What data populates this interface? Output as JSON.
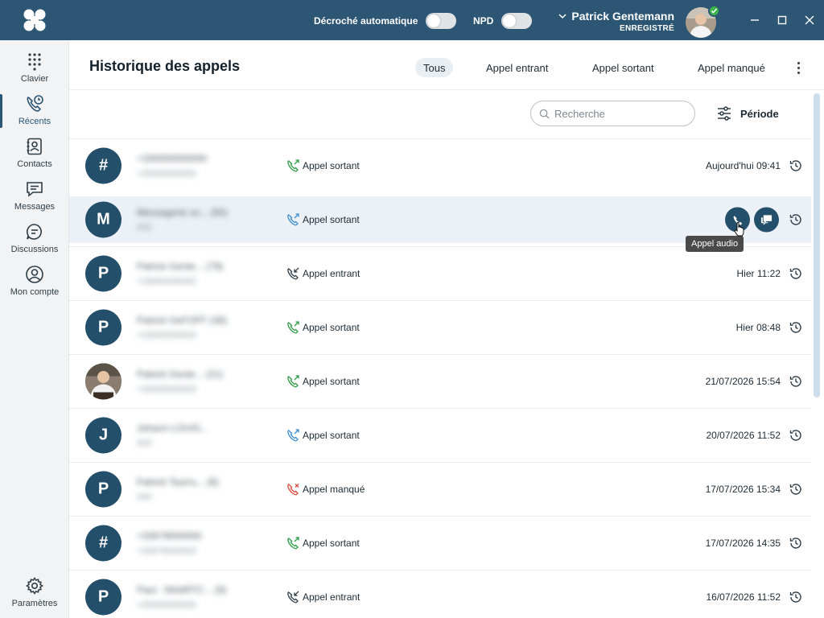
{
  "topbar": {
    "auto_answer_label": "Décroché automatique",
    "npd_label": "NPD",
    "user_name": "Patrick Gentemann",
    "user_status": "ENREGISTRÉ"
  },
  "sidebar": {
    "items": [
      {
        "label": "Clavier"
      },
      {
        "label": "Récents"
      },
      {
        "label": "Contacts"
      },
      {
        "label": "Messages"
      },
      {
        "label": "Discussions"
      },
      {
        "label": "Mon compte"
      }
    ],
    "settings_label": "Paramètres"
  },
  "header": {
    "title": "Historique des appels",
    "tabs": [
      {
        "label": "Tous"
      },
      {
        "label": "Appel entrant"
      },
      {
        "label": "Appel sortant"
      },
      {
        "label": "Appel manqué"
      }
    ]
  },
  "search": {
    "placeholder": "Recherche"
  },
  "period_label": "Période",
  "tooltip": "Appel audio",
  "colors": {
    "brand": "#2c5674",
    "avatar": "#234f6a",
    "outgoing": "#2e9b47",
    "outgoing_alt": "#3d8fd1",
    "missed": "#d9473f",
    "incoming": "#2f3d47"
  },
  "calls": [
    {
      "initial": "#",
      "name": "+330000000000",
      "sub": "+33000000000",
      "type": "Appel sortant",
      "icon": "outgoing-green",
      "when": "Aujourd'hui 09:41"
    },
    {
      "initial": "M",
      "name": "Messagerie vo...  (50)",
      "sub": "000",
      "type": "Appel sortant",
      "icon": "outgoing-blue",
      "when": ""
    },
    {
      "initial": "P",
      "name": "Patrick Gente...  (78)",
      "sub": "+33000000000",
      "type": "Appel entrant",
      "icon": "incoming",
      "when": "Hier 11:22"
    },
    {
      "initial": "P",
      "name": "Patrick GeFOFF (38)",
      "sub": "+33000000000",
      "type": "Appel sortant",
      "icon": "outgoing-green",
      "when": "Hier 08:48"
    },
    {
      "initial": "",
      "name": "Patrick Gente...  (21)",
      "sub": "+33000000000",
      "type": "Appel sortant",
      "icon": "outgoing-green",
      "when": "21/07/2026 15:54"
    },
    {
      "initial": "J",
      "name": "Johann LOUIS...",
      "sub": "000",
      "type": "Appel sortant",
      "icon": "outgoing-blue",
      "when": "20/07/2026 11:52"
    },
    {
      "initial": "P",
      "name": "Patrick Taurru...  (8)",
      "sub": "000",
      "type": "Appel manqué",
      "icon": "missed",
      "when": "17/07/2026 15:34"
    },
    {
      "initial": "#",
      "name": "+33679000000",
      "sub": "+33679000000",
      "type": "Appel sortant",
      "icon": "outgoing-green",
      "when": "17/07/2026 14:35"
    },
    {
      "initial": "P",
      "name": "Paul - WebRTC...  (9)",
      "sub": "+33000000000",
      "type": "Appel entrant",
      "icon": "incoming",
      "when": "16/07/2026 11:52"
    }
  ]
}
